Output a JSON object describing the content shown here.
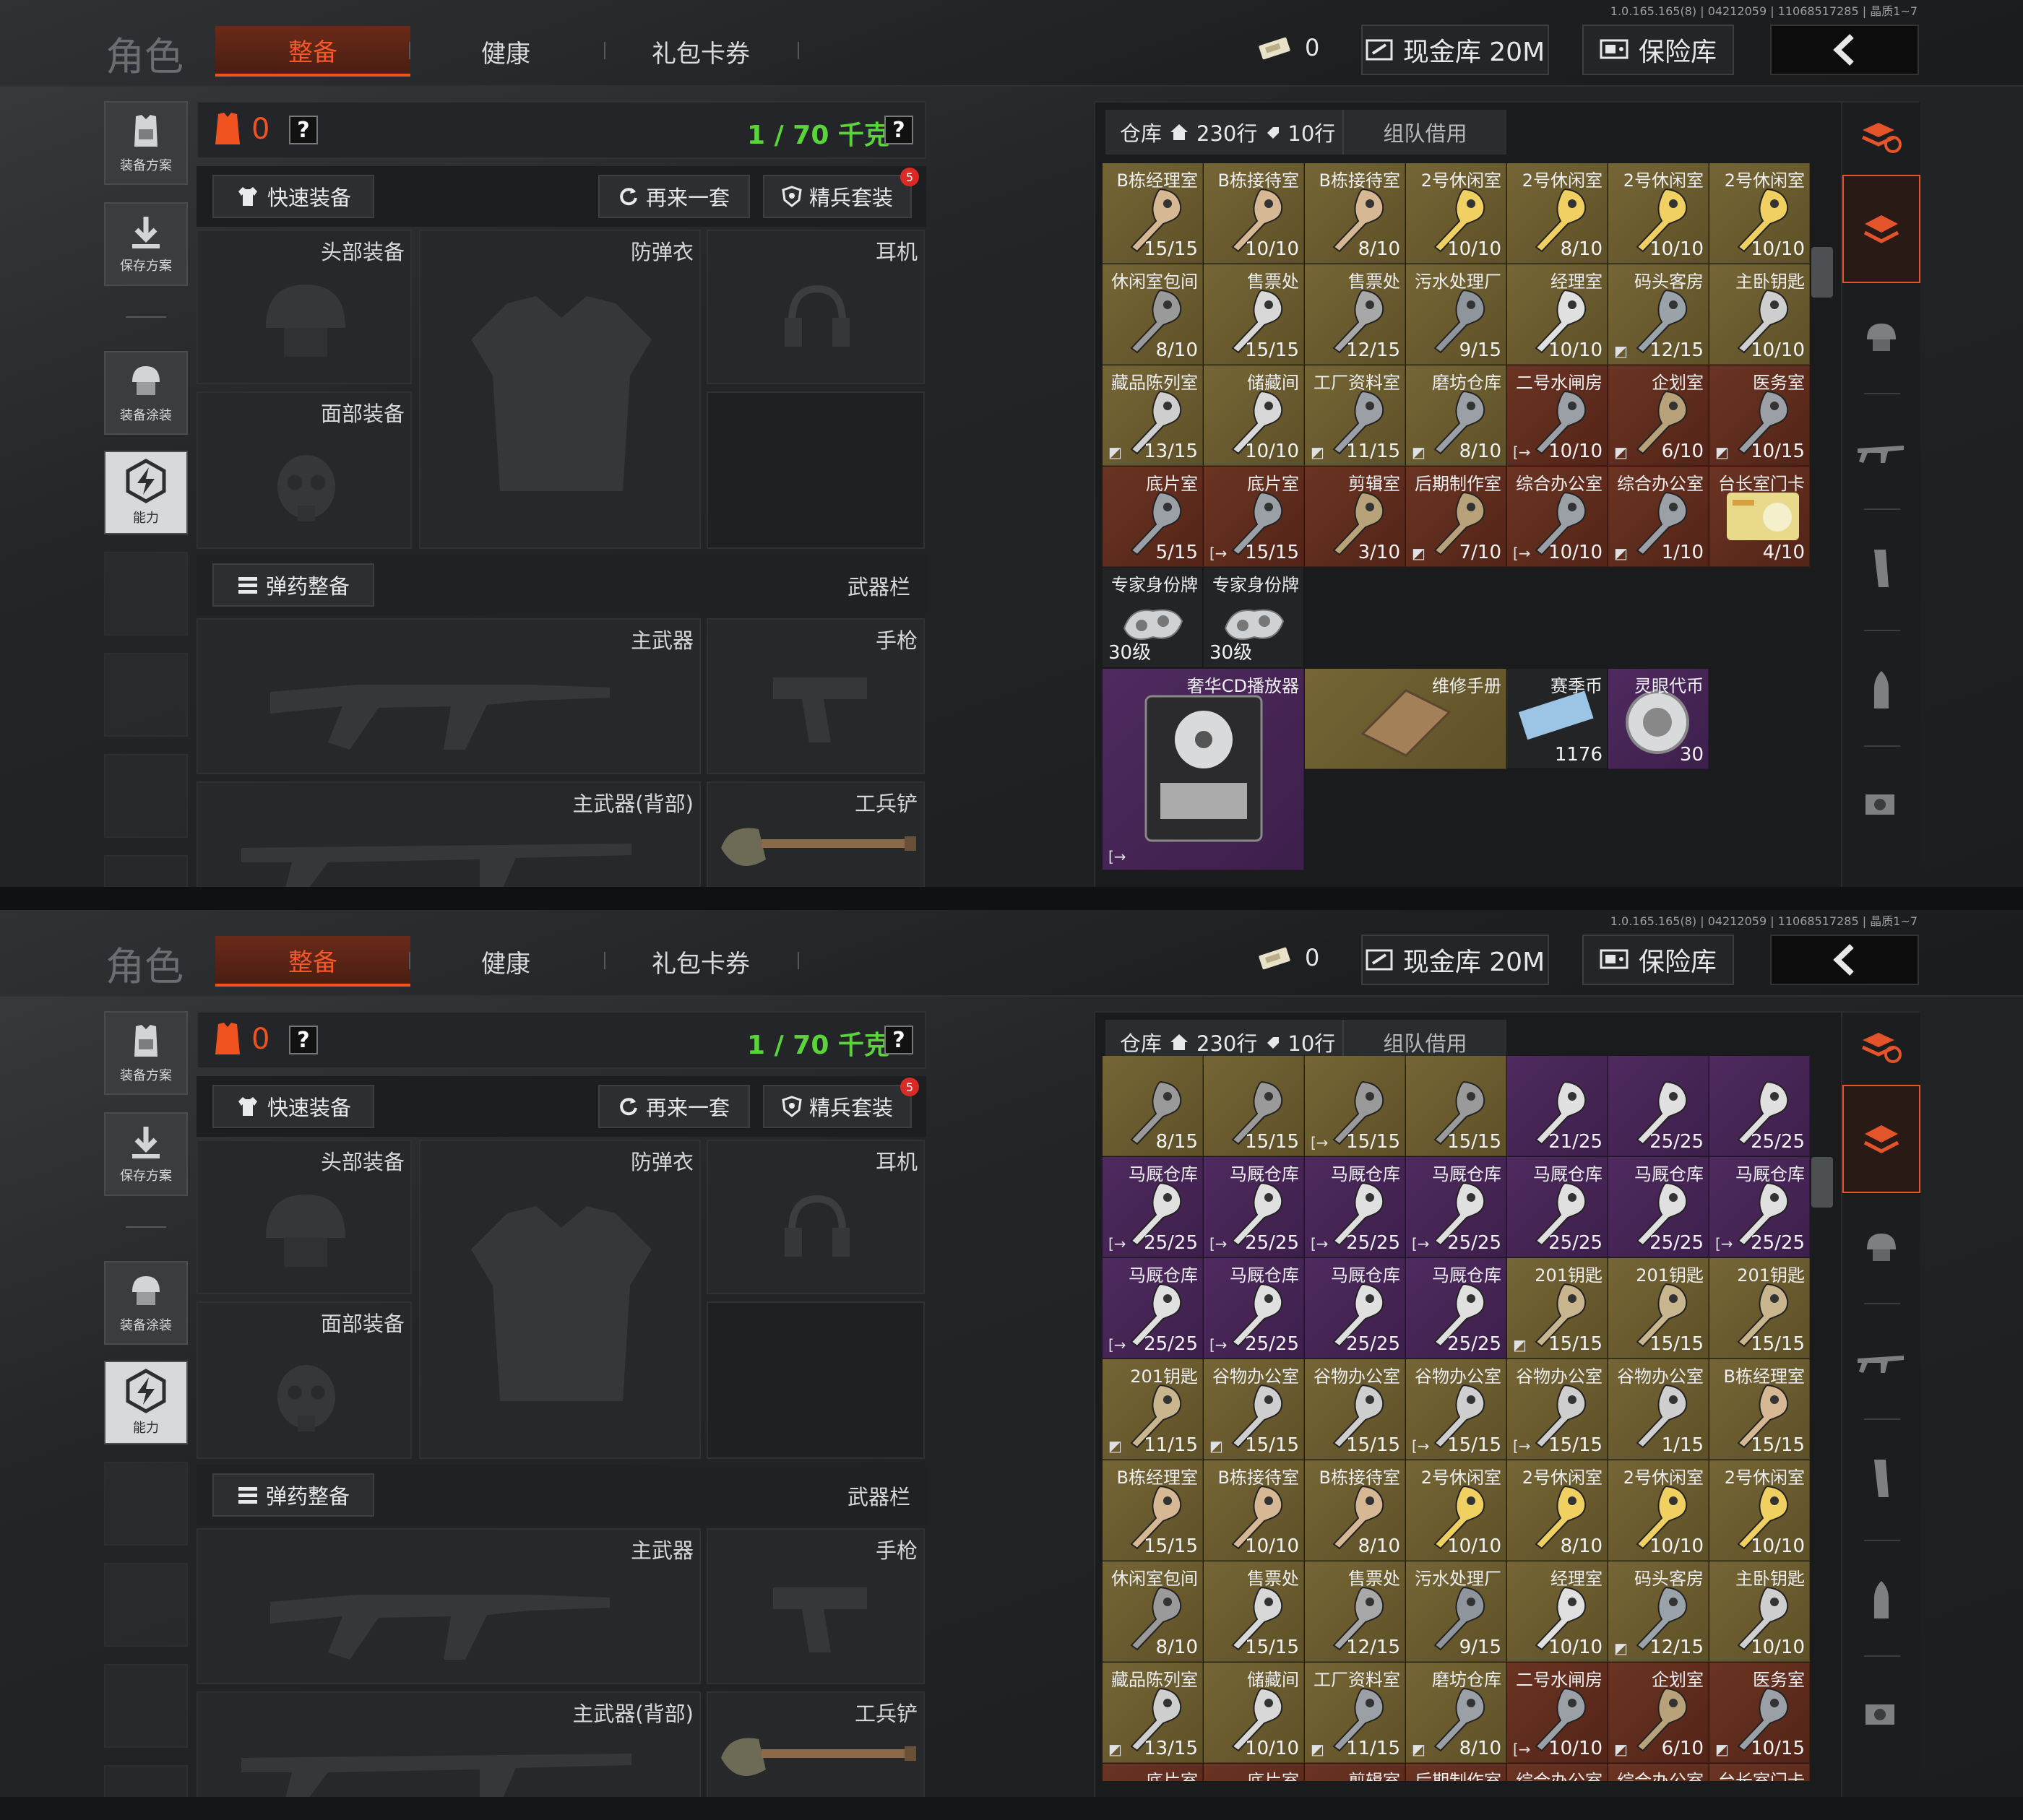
{
  "version": "1.0.165.165(8) | 04212059 | 11068517285 | 晶质1~7",
  "nav": {
    "role": "角色",
    "tabs": [
      "整备",
      "健康",
      "礼包卡券"
    ],
    "ticket_count": "0",
    "cash": "现金库 20M",
    "vault": "保险库"
  },
  "sidebar": [
    "装备方案",
    "保存方案",
    "装备涂装",
    "能力"
  ],
  "equip": {
    "armor_count": "0",
    "help": "?",
    "weight": "1 / 70 千克",
    "quick": "快速装备",
    "again": "再来一套",
    "elite": "精兵套装",
    "elite_badge": "5",
    "head": "头部装备",
    "vest": "防弹衣",
    "earphone": "耳机",
    "face": "面部装备",
    "ammo": "弹药整备",
    "weapon_bar": "武器栏",
    "primary": "主武器",
    "pistol": "手枪",
    "primary_back": "主武器(背部)",
    "shovel": "工兵铲"
  },
  "storage": {
    "title": "仓库",
    "rows": "230行",
    "rows2": "10行",
    "team": "组队借用"
  },
  "accent": "#f0531f",
  "screen1_cells": [
    {
      "name": "B栋经理室",
      "count": "15/15",
      "bg": "ybg",
      "kc": "#d6b894"
    },
    {
      "name": "B栋接待室",
      "count": "10/10",
      "bg": "ybg",
      "kc": "#d6b894"
    },
    {
      "name": "B栋接待室",
      "count": "8/10",
      "bg": "ybg",
      "kc": "#d6b894"
    },
    {
      "name": "2号休闲室",
      "count": "10/10",
      "bg": "ybg",
      "kc": "#f0d060"
    },
    {
      "name": "2号休闲室",
      "count": "8/10",
      "bg": "ybg",
      "kc": "#f0d060"
    },
    {
      "name": "2号休闲室",
      "count": "10/10",
      "bg": "ybg",
      "kc": "#f0d060"
    },
    {
      "name": "2号休闲室",
      "count": "10/10",
      "bg": "ybg",
      "kc": "#f0d060"
    },
    {
      "name": "休闲室包间",
      "count": "8/10",
      "bg": "ybg",
      "kc": "#9a9a9a"
    },
    {
      "name": "售票处",
      "count": "15/15",
      "bg": "ybg",
      "kc": "#d8d8d8"
    },
    {
      "name": "售票处",
      "count": "12/15",
      "bg": "ybg",
      "kc": "#a8a8a8"
    },
    {
      "name": "污水处理厂",
      "count": "9/15",
      "bg": "ybg",
      "kc": "#8e959c"
    },
    {
      "name": "经理室",
      "count": "10/10",
      "bg": "ybg",
      "kc": "#e0e0e0"
    },
    {
      "name": "码头客房",
      "count": "12/15",
      "bg": "ybg",
      "kc": "#9aa3aa",
      "mark": "◩"
    },
    {
      "name": "主卧钥匙",
      "count": "10/10",
      "bg": "ybg",
      "kc": "#cfcfcf"
    },
    {
      "name": "藏品陈列室",
      "count": "13/15",
      "bg": "ybg",
      "kc": "#cfcfcf",
      "mark": "◩"
    },
    {
      "name": "储藏间",
      "count": "10/10",
      "bg": "ybg",
      "kc": "#d8d8d8"
    },
    {
      "name": "工厂资料室",
      "count": "11/15",
      "bg": "ybg",
      "kc": "#9aa0a6",
      "mark": "◩"
    },
    {
      "name": "磨坊仓库",
      "count": "8/10",
      "bg": "ybg",
      "kc": "#9aa0a6",
      "mark": "◩"
    },
    {
      "name": "二号水闸房",
      "count": "10/10",
      "bg": "rbg",
      "kc": "#9aa0a6",
      "mark": "[→"
    },
    {
      "name": "企划室",
      "count": "6/10",
      "bg": "rbg",
      "kc": "#b8a27a",
      "mark": "◩"
    },
    {
      "name": "医务室",
      "count": "10/15",
      "bg": "rbg",
      "kc": "#9aa0a6",
      "mark": "◩"
    },
    {
      "name": "底片室",
      "count": "5/15",
      "bg": "rbg",
      "kc": "#9aa0a6"
    },
    {
      "name": "底片室",
      "count": "15/15",
      "bg": "rbg",
      "kc": "#9aa0a6",
      "mark": "[→"
    },
    {
      "name": "剪辑室",
      "count": "3/10",
      "bg": "rbg",
      "kc": "#b8a27a"
    },
    {
      "name": "后期制作室",
      "count": "7/10",
      "bg": "rbg",
      "kc": "#b8a27a",
      "mark": "◩"
    },
    {
      "name": "综合办公室",
      "count": "10/10",
      "bg": "rbg",
      "kc": "#9aa0a6",
      "mark": "[→"
    },
    {
      "name": "综合办公室",
      "count": "1/10",
      "bg": "rbg",
      "kc": "#9aa0a6",
      "mark": "◩"
    },
    {
      "name": "台长室门卡",
      "count": "4/10",
      "bg": "rbg",
      "card": true
    },
    {
      "name": "专家身份牌",
      "count": "30级",
      "bg": "gbg",
      "tag": true
    },
    {
      "name": "专家身份牌",
      "count": "30级",
      "bg": "gbg",
      "tag": true
    }
  ],
  "screen1_special": [
    {
      "name": "奢华CD播放器",
      "mark": "[→"
    },
    {
      "name": "维修手册"
    },
    {
      "name": "赛季币",
      "count": "1176"
    },
    {
      "name": "灵眼代币",
      "count": "30"
    }
  ],
  "screen2_cells": [
    {
      "name": "",
      "count": "8/15",
      "bg": "ybg",
      "kc": "#9a9a9a"
    },
    {
      "name": "",
      "count": "15/15",
      "bg": "ybg",
      "kc": "#9a9a9a"
    },
    {
      "name": "",
      "count": "15/15",
      "bg": "ybg",
      "kc": "#9a9a9a",
      "mark": "[→"
    },
    {
      "name": "",
      "count": "15/15",
      "bg": "ybg",
      "kc": "#9a9a9a"
    },
    {
      "name": "",
      "count": "21/25",
      "bg": "pbg",
      "kc": "#e0e0e0"
    },
    {
      "name": "",
      "count": "25/25",
      "bg": "pbg",
      "kc": "#e0e0e0"
    },
    {
      "name": "",
      "count": "25/25",
      "bg": "pbg",
      "kc": "#e0e0e0"
    },
    {
      "name": "马厩仓库",
      "count": "25/25",
      "bg": "pbg",
      "kc": "#e0e0e0",
      "mark": "[→"
    },
    {
      "name": "马厩仓库",
      "count": "25/25",
      "bg": "pbg",
      "kc": "#e0e0e0",
      "mark": "[→"
    },
    {
      "name": "马厩仓库",
      "count": "25/25",
      "bg": "pbg",
      "kc": "#e0e0e0",
      "mark": "[→"
    },
    {
      "name": "马厩仓库",
      "count": "25/25",
      "bg": "pbg",
      "kc": "#e0e0e0",
      "mark": "[→"
    },
    {
      "name": "马厩仓库",
      "count": "25/25",
      "bg": "pbg",
      "kc": "#e0e0e0"
    },
    {
      "name": "马厩仓库",
      "count": "25/25",
      "bg": "pbg",
      "kc": "#e0e0e0"
    },
    {
      "name": "马厩仓库",
      "count": "25/25",
      "bg": "pbg",
      "kc": "#e0e0e0",
      "mark": "[→"
    },
    {
      "name": "马厩仓库",
      "count": "25/25",
      "bg": "pbg",
      "kc": "#e0e0e0",
      "mark": "[→"
    },
    {
      "name": "马厩仓库",
      "count": "25/25",
      "bg": "pbg",
      "kc": "#e0e0e0",
      "mark": "[→"
    },
    {
      "name": "马厩仓库",
      "count": "25/25",
      "bg": "pbg",
      "kc": "#e0e0e0"
    },
    {
      "name": "马厩仓库",
      "count": "25/25",
      "bg": "pbg",
      "kc": "#e0e0e0"
    },
    {
      "name": "201钥匙",
      "count": "15/15",
      "bg": "ybg",
      "kc": "#c9b68e",
      "mark": "◩"
    },
    {
      "name": "201钥匙",
      "count": "15/15",
      "bg": "ybg",
      "kc": "#c9b68e"
    },
    {
      "name": "201钥匙",
      "count": "15/15",
      "bg": "ybg",
      "kc": "#c9b68e"
    },
    {
      "name": "201钥匙",
      "count": "11/15",
      "bg": "ybg",
      "kc": "#c9b68e",
      "mark": "◩"
    },
    {
      "name": "谷物办公室",
      "count": "15/15",
      "bg": "ybg",
      "kc": "#cfcfcf",
      "mark": "◩"
    },
    {
      "name": "谷物办公室",
      "count": "15/15",
      "bg": "ybg",
      "kc": "#cfcfcf"
    },
    {
      "name": "谷物办公室",
      "count": "15/15",
      "bg": "ybg",
      "kc": "#cfcfcf",
      "mark": "[→"
    },
    {
      "name": "谷物办公室",
      "count": "15/15",
      "bg": "ybg",
      "kc": "#cfcfcf",
      "mark": "[→"
    },
    {
      "name": "谷物办公室",
      "count": "1/15",
      "bg": "ybg",
      "kc": "#cfcfcf"
    },
    {
      "name": "B栋经理室",
      "count": "15/15",
      "bg": "ybg",
      "kc": "#d6b894"
    },
    {
      "name": "B栋经理室",
      "count": "15/15",
      "bg": "ybg",
      "kc": "#d6b894"
    },
    {
      "name": "B栋接待室",
      "count": "10/10",
      "bg": "ybg",
      "kc": "#d6b894"
    },
    {
      "name": "B栋接待室",
      "count": "8/10",
      "bg": "ybg",
      "kc": "#d6b894"
    },
    {
      "name": "2号休闲室",
      "count": "10/10",
      "bg": "ybg",
      "kc": "#f0d060"
    },
    {
      "name": "2号休闲室",
      "count": "8/10",
      "bg": "ybg",
      "kc": "#f0d060"
    },
    {
      "name": "2号休闲室",
      "count": "10/10",
      "bg": "ybg",
      "kc": "#f0d060"
    },
    {
      "name": "2号休闲室",
      "count": "10/10",
      "bg": "ybg",
      "kc": "#f0d060"
    },
    {
      "name": "休闲室包间",
      "count": "8/10",
      "bg": "ybg",
      "kc": "#9a9a9a"
    },
    {
      "name": "售票处",
      "count": "15/15",
      "bg": "ybg",
      "kc": "#d8d8d8"
    },
    {
      "name": "售票处",
      "count": "12/15",
      "bg": "ybg",
      "kc": "#a8a8a8"
    },
    {
      "name": "污水处理厂",
      "count": "9/15",
      "bg": "ybg",
      "kc": "#8e959c"
    },
    {
      "name": "经理室",
      "count": "10/10",
      "bg": "ybg",
      "kc": "#e0e0e0"
    },
    {
      "name": "码头客房",
      "count": "12/15",
      "bg": "ybg",
      "kc": "#9aa3aa",
      "mark": "◩"
    },
    {
      "name": "主卧钥匙",
      "count": "10/10",
      "bg": "ybg",
      "kc": "#cfcfcf"
    },
    {
      "name": "藏品陈列室",
      "count": "13/15",
      "bg": "ybg",
      "kc": "#cfcfcf",
      "mark": "◩"
    },
    {
      "name": "储藏间",
      "count": "10/10",
      "bg": "ybg",
      "kc": "#d8d8d8"
    },
    {
      "name": "工厂资料室",
      "count": "11/15",
      "bg": "ybg",
      "kc": "#9aa0a6",
      "mark": "◩"
    },
    {
      "name": "磨坊仓库",
      "count": "8/10",
      "bg": "ybg",
      "kc": "#9aa0a6",
      "mark": "◩"
    },
    {
      "name": "二号水闸房",
      "count": "10/10",
      "bg": "rbg",
      "kc": "#9aa0a6",
      "mark": "[→"
    },
    {
      "name": "企划室",
      "count": "6/10",
      "bg": "rbg",
      "kc": "#b8a27a",
      "mark": "◩"
    },
    {
      "name": "医务室",
      "count": "10/15",
      "bg": "rbg",
      "kc": "#9aa0a6",
      "mark": "◩"
    },
    {
      "name": "底片室",
      "count": "",
      "bg": "rbg",
      "kc": "#9aa0a6"
    },
    {
      "name": "底片室",
      "count": "",
      "bg": "rbg",
      "kc": "#9aa0a6"
    },
    {
      "name": "剪辑室",
      "count": "",
      "bg": "rbg",
      "kc": "#b8a27a"
    },
    {
      "name": "后期制作室",
      "count": "",
      "bg": "rbg",
      "kc": "#b8a27a"
    },
    {
      "name": "综合办公室",
      "count": "",
      "bg": "rbg",
      "kc": "#9aa0a6"
    },
    {
      "name": "综合办公室",
      "count": "",
      "bg": "rbg",
      "kc": "#9aa0a6"
    },
    {
      "name": "台长室门卡",
      "count": "",
      "bg": "rbg",
      "card": true
    }
  ]
}
